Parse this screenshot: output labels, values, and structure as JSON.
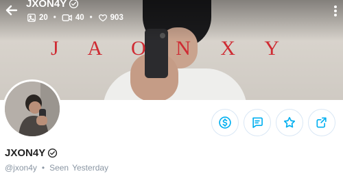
{
  "header": {
    "username": "JXON4Y",
    "stats": {
      "photos": "20",
      "videos": "40",
      "likes": "903"
    }
  },
  "cover": {
    "watermark": "J A O   N X Y"
  },
  "profile": {
    "display_name": "JXON4Y",
    "handle": "@jxon4y",
    "seen_label": "Seen",
    "seen_value": "Yesterday"
  },
  "colors": {
    "accent": "#00aff0",
    "watermark": "#cf2b33",
    "muted": "#8a96a3"
  },
  "icons": [
    "back-arrow-icon",
    "verified-badge-icon",
    "image-icon",
    "video-icon",
    "heart-icon",
    "more-vertical-icon",
    "dollar-icon",
    "message-icon",
    "star-icon",
    "share-icon"
  ]
}
